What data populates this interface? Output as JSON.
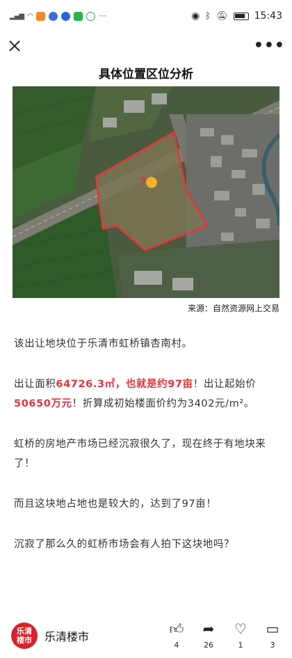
{
  "status": {
    "time": "15:43"
  },
  "nav": {
    "more": "•••"
  },
  "article": {
    "title": "具体位置区位分析",
    "map_caption": "来源：自然资源网上交易",
    "p1": "该出让地块位于乐清市虹桥镇杏南村。",
    "p2_a": "出让面积",
    "p2_b": "64726.3㎡，也就是约97亩",
    "p2_c": "！出让起始价",
    "p2_d": "50650万元",
    "p2_e": "！折算成初始楼面价约为3402元/m²。",
    "p3": "虹桥的房地产市场已经沉寂很久了，现在终于有地块来了！",
    "p4": "而且这块地占地也是较大的，达到了97亩！",
    "p5": "沉寂了那么久的虹桥市场会有人拍下这块地吗？"
  },
  "bottom": {
    "logo_text": "乐清楼市",
    "account": "乐清楼市",
    "like_count": "4",
    "share_count": "26",
    "fav_count": "1",
    "comment_count": "3"
  },
  "colors": {
    "highlight": "#e0333d",
    "logo": "#d8232a",
    "boundary": "#e8343a"
  }
}
